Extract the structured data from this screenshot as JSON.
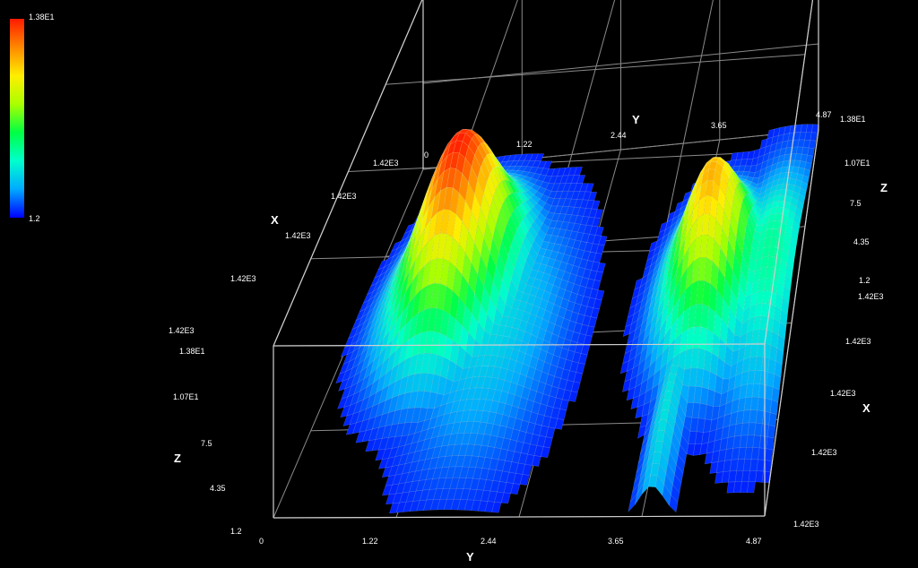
{
  "chart_data": {
    "type": "surface3d",
    "title": "",
    "colormap": [
      "#0000ff",
      "#00aaff",
      "#00ffcc",
      "#00ff44",
      "#aaff00",
      "#ffee00",
      "#ff8800",
      "#ff1a00"
    ],
    "legend": {
      "max_label": "1.38E1",
      "min_label": "1.2",
      "range": [
        1.2,
        13.8
      ]
    },
    "axes": {
      "x": {
        "label": "X",
        "tick_labels": [
          "1.42E3",
          "1.42E3",
          "1.42E3",
          "1.42E3",
          "1.42E3"
        ]
      },
      "y": {
        "label": "Y",
        "range": [
          0,
          4.87
        ],
        "tick_labels": [
          "0",
          "1.22",
          "2.44",
          "3.65",
          "4.87"
        ]
      },
      "z": {
        "label": "Z",
        "range": [
          1.2,
          13.8
        ],
        "tick_labels": [
          "1.38E1",
          "1.07E1",
          "7.5",
          "4.35",
          "1.2"
        ]
      }
    },
    "peaks": [
      {
        "name": "",
        "y": 1.1,
        "x_frac": 0.58,
        "z": 13.8,
        "sy": 0.42,
        "sx": 0.16
      },
      {
        "name": "",
        "y": 3.95,
        "x_frac": 0.55,
        "z": 11.4,
        "sy": 0.34,
        "sx": 0.15
      }
    ],
    "ridges": [
      {
        "y": 3.75,
        "x_frac": 0.2,
        "z": 4.3,
        "sy": 0.12,
        "sx": 0.25
      },
      {
        "y": 1.7,
        "x_frac": 0.45,
        "z": 4.0,
        "sy": 0.5,
        "sx": 0.25
      },
      {
        "y": 4.6,
        "x_frac": 0.55,
        "z": 5.5,
        "sy": 0.35,
        "sx": 0.22
      }
    ],
    "grid": true
  }
}
